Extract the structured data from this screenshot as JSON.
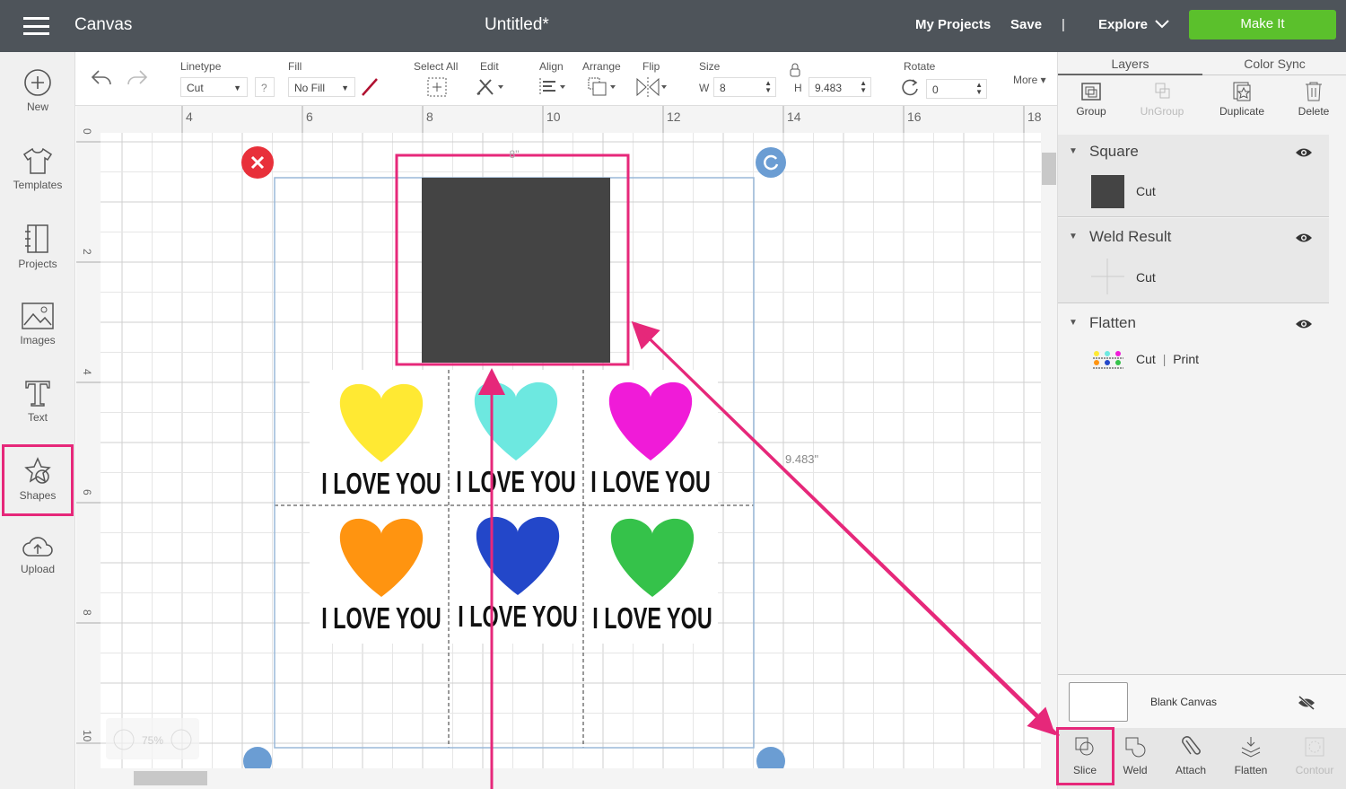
{
  "header": {
    "app": "Canvas",
    "title": "Untitled*",
    "my_projects": "My Projects",
    "save": "Save",
    "divider": "|",
    "explore": "Explore",
    "make_it": "Make It",
    "make_it_color": "#5bc02c"
  },
  "sidebar": {
    "items": [
      {
        "label": "New",
        "icon": "plus-circle-icon"
      },
      {
        "label": "Templates",
        "icon": "shirt-icon"
      },
      {
        "label": "Projects",
        "icon": "projects-icon"
      },
      {
        "label": "Images",
        "icon": "image-icon"
      },
      {
        "label": "Text",
        "icon": "text-icon"
      },
      {
        "label": "Shapes",
        "icon": "shapes-icon"
      },
      {
        "label": "Upload",
        "icon": "upload-cloud-icon"
      }
    ]
  },
  "toolbar": {
    "linetype_label": "Linetype",
    "linetype_value": "Cut",
    "help": "?",
    "fill_label": "Fill",
    "fill_value": "No Fill",
    "select_all": "Select All",
    "edit": "Edit",
    "align": "Align",
    "arrange": "Arrange",
    "flip": "Flip",
    "size_label": "Size",
    "w_label": "W",
    "w_value": "8",
    "h_label": "H",
    "h_value": "9.483",
    "rotate_label": "Rotate",
    "rotate_value": "0",
    "more": "More"
  },
  "ruler": {
    "x": [
      "4",
      "6",
      "8",
      "10",
      "12",
      "14",
      "16",
      "18"
    ],
    "y": [
      "0",
      "2",
      "4",
      "6",
      "8",
      "10"
    ]
  },
  "canvas": {
    "width_dim": "8\"",
    "height_dim": "9.483\"",
    "zoom": "75%",
    "tile_text": "I LOVE YOU",
    "hearts": [
      "#ffe933",
      "#6de8e0",
      "#f01bd8",
      "#ff9410",
      "#2347c9",
      "#35c24a"
    ],
    "square_color": "#444444",
    "accent": "#e6287a"
  },
  "panel": {
    "tabs": [
      "Layers",
      "Color Sync"
    ],
    "actions": [
      "Group",
      "UnGroup",
      "Duplicate",
      "Delete"
    ],
    "layers": [
      {
        "name": "Square",
        "type": "Cut"
      },
      {
        "name": "Weld Result",
        "type": "Cut"
      },
      {
        "name": "Flatten",
        "type": "Cut",
        "type2": "Print",
        "sep": "|"
      }
    ],
    "blank_canvas": "Blank Canvas",
    "bottom": [
      "Slice",
      "Weld",
      "Attach",
      "Flatten",
      "Contour"
    ]
  }
}
